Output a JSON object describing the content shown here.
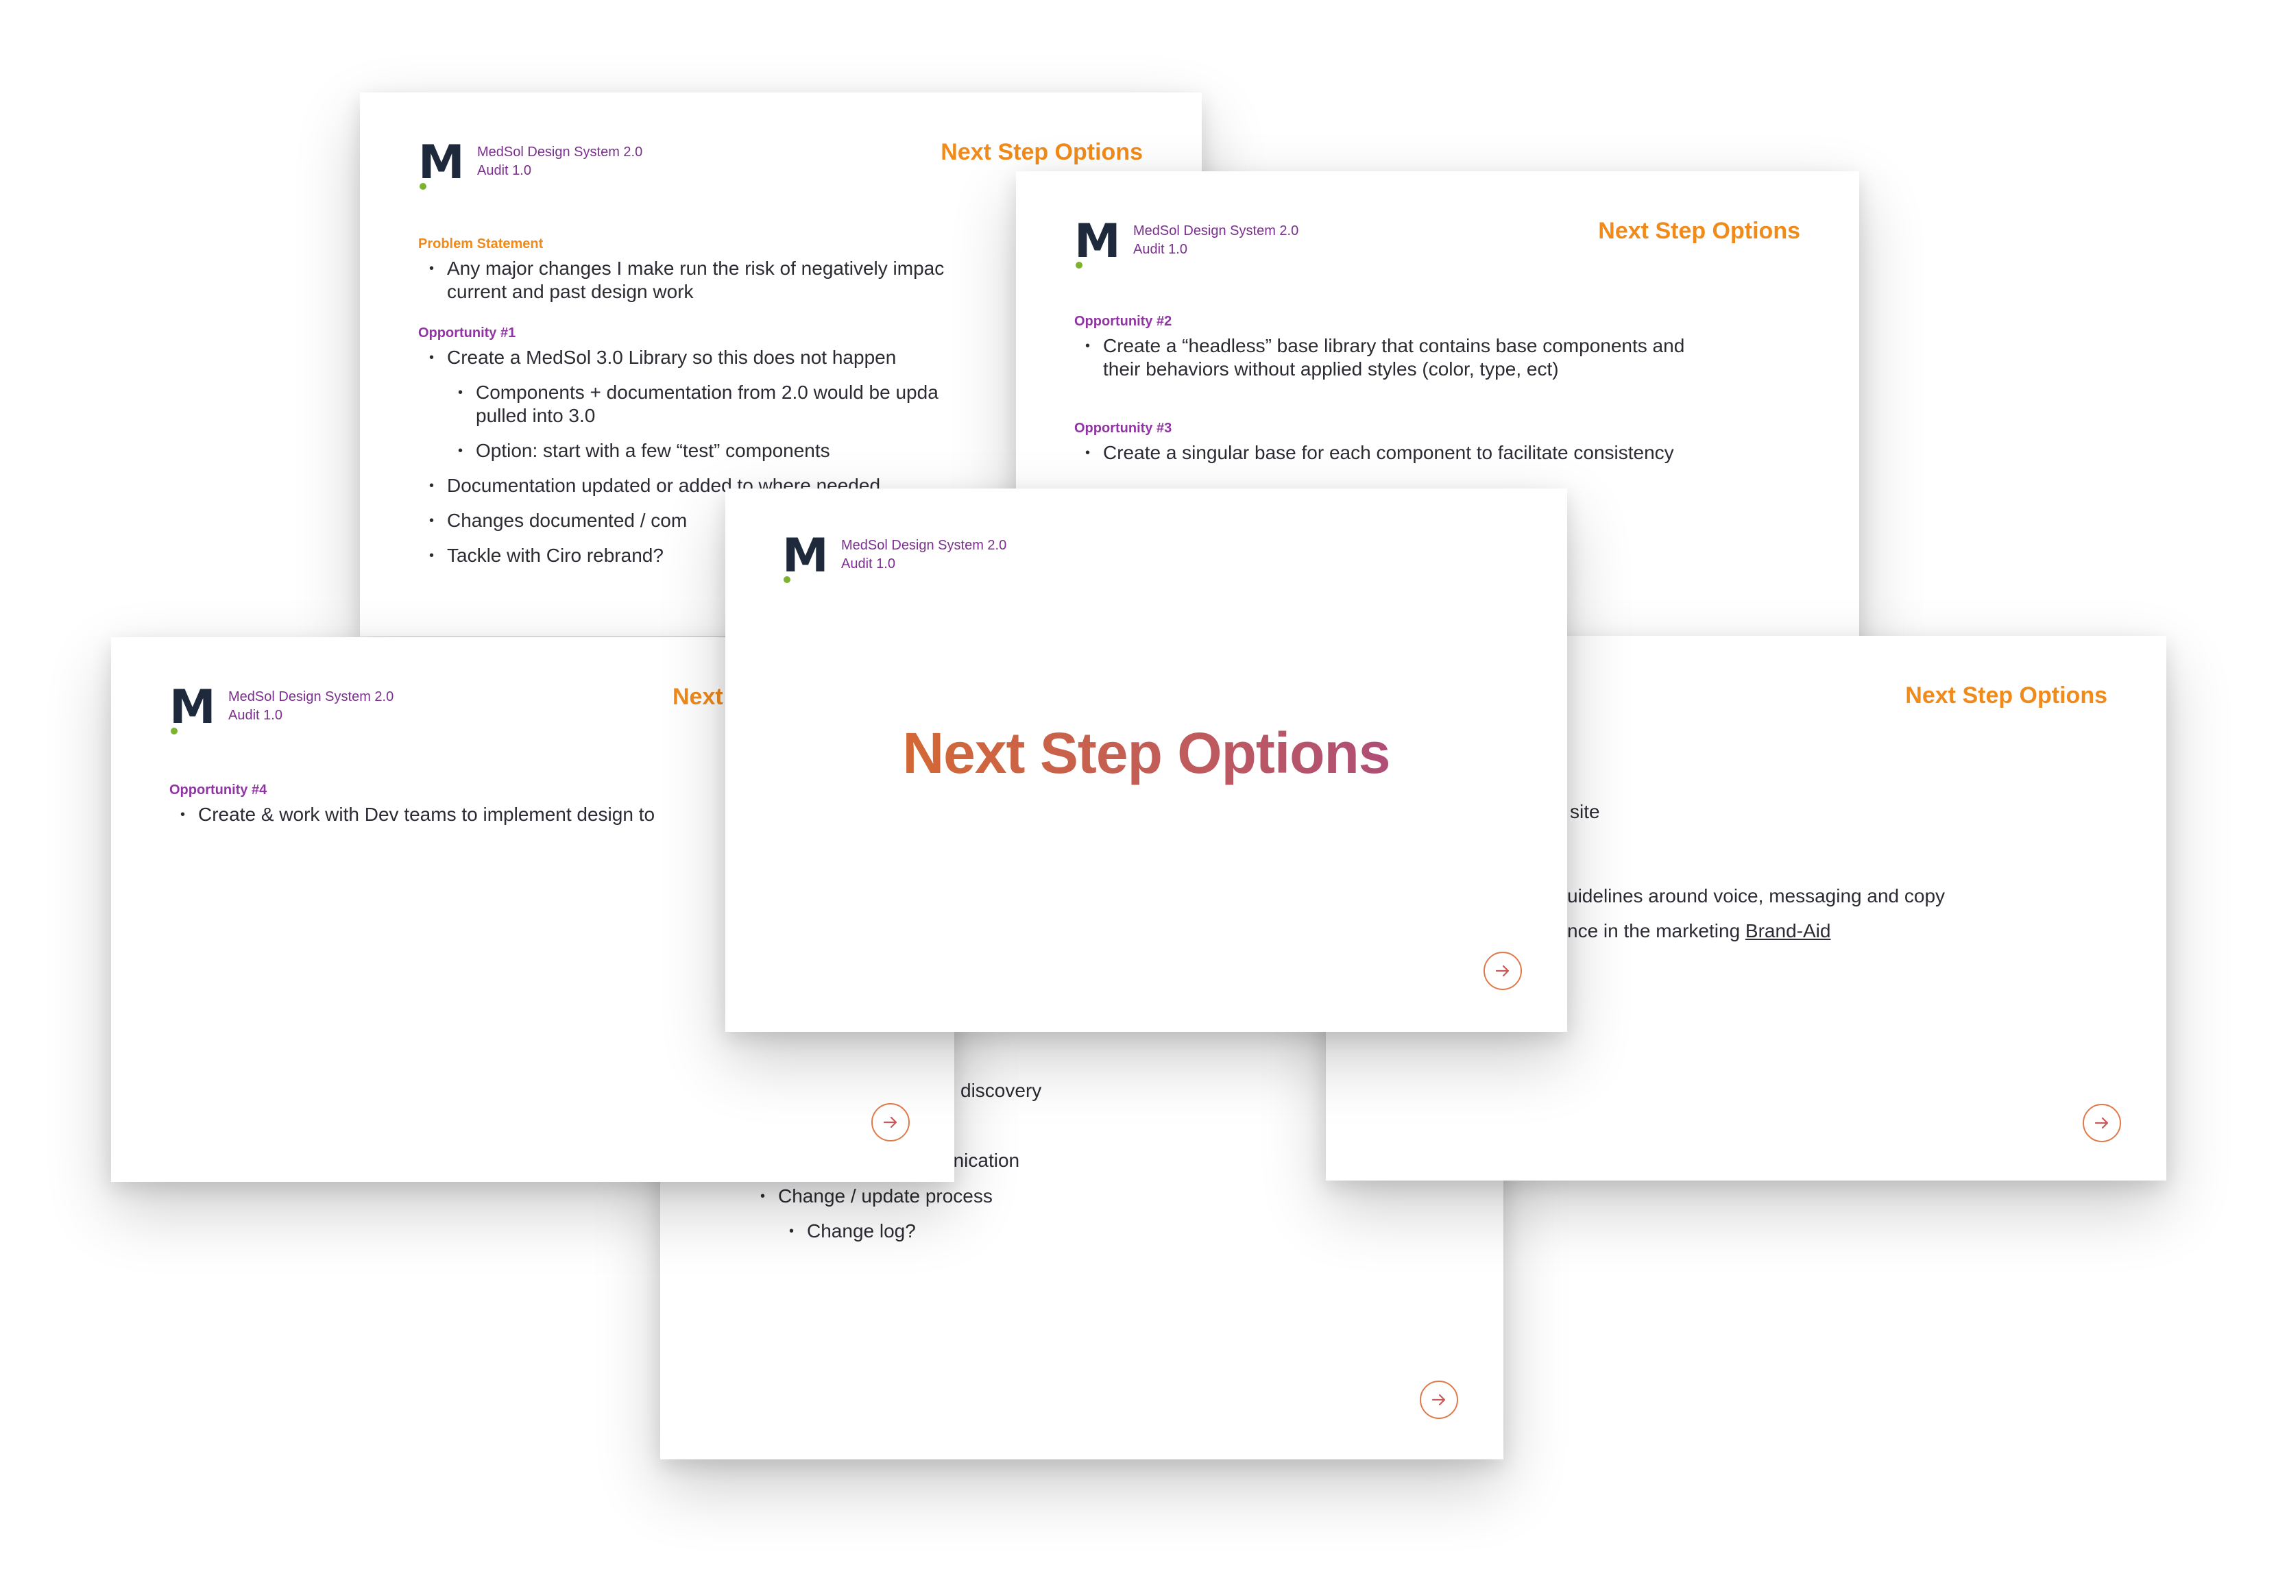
{
  "brand": {
    "logo_letter": "M",
    "name": "MedSol Design System 2.0",
    "version": "Audit 1.0"
  },
  "colors": {
    "accent_orange": "#f08a1a",
    "label_purple": "#9034a3",
    "brand_purple": "#7a2f8c",
    "logo_navy": "#1e2a3c",
    "logo_dot_green": "#7bb32e"
  },
  "slide_title": "Next Step Options",
  "slide1": {
    "problem_label": "Problem Statement",
    "problem_bullet_line1": "Any major changes I make run the risk of negatively impac",
    "problem_bullet_line2": "current and past design work",
    "opp_label": "Opportunity #1",
    "bullets": [
      "Create a MedSol 3.0 Library so this does not happen",
      "Components + documentation from 2.0 would be upda",
      "pulled into 3.0",
      "Option: start with a few “test” components",
      "Documentation updated or added to where needed",
      "Changes documented / com",
      "Tackle with Ciro rebrand?"
    ]
  },
  "slide2": {
    "opp2_label": "Opportunity #2",
    "opp2_line1": "Create a “headless” base library that contains base components and",
    "opp2_line2": "their behaviors without applied styles (color, type, ect)",
    "opp3_label": "Opportunity #3",
    "opp3_line1": "Create a singular base for each component to facilitate consistency"
  },
  "slide3": {
    "opp4_label": "Opportunity #4",
    "opp4_line1": "Create & work with Dev teams to implement design to",
    "title_fragment": "Next"
  },
  "slide4": {
    "fragments": [
      "site",
      "uidelines around voice, messaging and copy",
      "nce in the marketing "
    ],
    "link_text": "Brand-Aid"
  },
  "slide5": {
    "fragments": [
      "discovery",
      "unication"
    ],
    "bullets": [
      "Change / update process",
      "Change log?"
    ]
  },
  "center": {
    "title": "Next Step Options"
  }
}
